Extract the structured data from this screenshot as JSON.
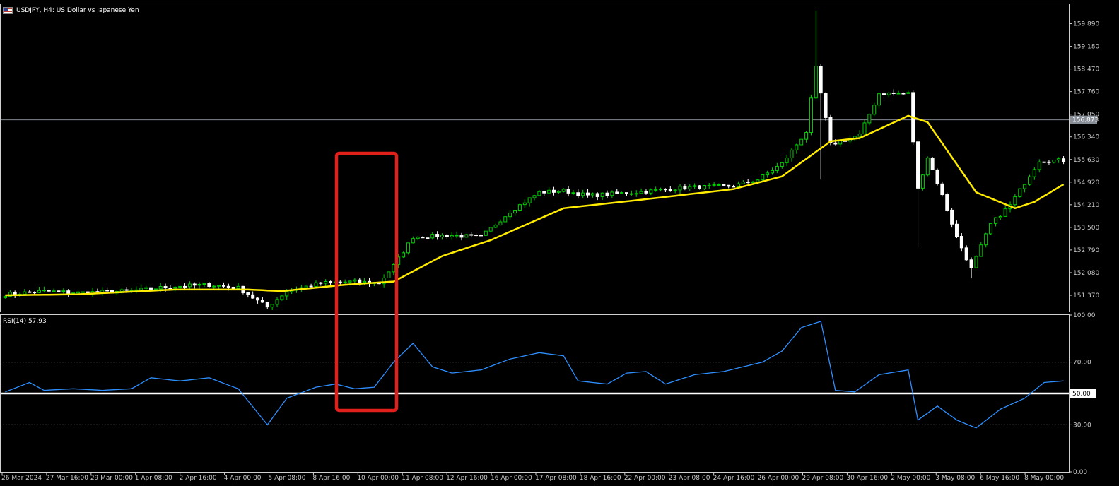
{
  "header": {
    "symbol_label": "USDJPY, H4:  US Dollar vs Japanese Yen",
    "flag_icon": "us-flag-icon"
  },
  "colors": {
    "background": "#000000",
    "grid_frame": "#d0d0d0",
    "candle_bull": "#00d000",
    "candle_bear": "#ffffff",
    "ma_line": "#ffeb00",
    "rsi_line": "#2f8fff",
    "rsi_mid_line": "#ffffff",
    "highlight_box": "#e0201b",
    "price_marker_bg": "#888f99"
  },
  "chart_data": [
    {
      "type": "candlestick",
      "name": "price",
      "ylim": [
        150.86,
        160.5
      ],
      "y_ticks": [
        "159.890",
        "159.180",
        "158.470",
        "157.760",
        "157.050",
        "156.340",
        "155.630",
        "154.920",
        "154.210",
        "153.500",
        "152.790",
        "152.080",
        "151.370"
      ],
      "current_price_label": "156.873",
      "current_price": 156.873,
      "x_tick_labels": [
        "26 Mar 2024",
        "27 Mar 16:00",
        "29 Mar 00:00",
        "1 Apr 08:00",
        "2 Apr 16:00",
        "4 Apr 00:00",
        "5 Apr 08:00",
        "8 Apr 16:00",
        "10 Apr 00:00",
        "11 Apr 08:00",
        "12 Apr 16:00",
        "16 Apr 00:00",
        "17 Apr 08:00",
        "18 Apr 16:00",
        "22 Apr 00:00",
        "23 Apr 08:00",
        "24 Apr 16:00",
        "26 Apr 00:00",
        "29 Apr 08:00",
        "30 Apr 16:00",
        "2 May 00:00",
        "3 May 08:00",
        "6 May 16:00",
        "8 May 00:00"
      ],
      "close_keyframes": [
        [
          0,
          151.4
        ],
        [
          8,
          151.5
        ],
        [
          15,
          151.45
        ],
        [
          25,
          151.5
        ],
        [
          35,
          151.65
        ],
        [
          42,
          151.7
        ],
        [
          48,
          151.6
        ],
        [
          54,
          151.0
        ],
        [
          58,
          151.5
        ],
        [
          65,
          151.75
        ],
        [
          72,
          151.8
        ],
        [
          77,
          151.75
        ],
        [
          80,
          152.3
        ],
        [
          84,
          153.2
        ],
        [
          92,
          153.25
        ],
        [
          98,
          153.2
        ],
        [
          104,
          154.0
        ],
        [
          110,
          154.6
        ],
        [
          115,
          154.65
        ],
        [
          120,
          154.5
        ],
        [
          130,
          154.6
        ],
        [
          140,
          154.75
        ],
        [
          150,
          154.8
        ],
        [
          155,
          155.0
        ],
        [
          160,
          155.5
        ],
        [
          165,
          156.5
        ],
        [
          167,
          158.5
        ],
        [
          170,
          156.1
        ],
        [
          176,
          156.4
        ],
        [
          180,
          157.7
        ],
        [
          186,
          157.7
        ],
        [
          188,
          154.7
        ],
        [
          190,
          155.7
        ],
        [
          193,
          154.5
        ],
        [
          196,
          153.2
        ],
        [
          199,
          152.2
        ],
        [
          203,
          153.6
        ],
        [
          207,
          154.2
        ],
        [
          213,
          155.6
        ],
        [
          218,
          155.6
        ]
      ],
      "moving_average_keyframes": [
        [
          0,
          151.37
        ],
        [
          15,
          151.4
        ],
        [
          35,
          151.55
        ],
        [
          50,
          151.55
        ],
        [
          57,
          151.5
        ],
        [
          70,
          151.7
        ],
        [
          80,
          151.8
        ],
        [
          90,
          152.6
        ],
        [
          100,
          153.1
        ],
        [
          115,
          154.1
        ],
        [
          130,
          154.35
        ],
        [
          150,
          154.7
        ],
        [
          160,
          155.1
        ],
        [
          170,
          156.2
        ],
        [
          176,
          156.3
        ],
        [
          186,
          157.0
        ],
        [
          190,
          156.8
        ],
        [
          195,
          155.7
        ],
        [
          200,
          154.6
        ],
        [
          208,
          154.1
        ],
        [
          212,
          154.3
        ],
        [
          218,
          154.85
        ]
      ]
    },
    {
      "type": "line",
      "name": "RSI(14)",
      "label": "RSI(14) 57.93",
      "ylim": [
        0,
        100
      ],
      "y_ticks": [
        "100.00",
        "70.00",
        "50.00",
        "30.00",
        "0.00"
      ],
      "levels": [
        30,
        50,
        70
      ],
      "rsi_keyframes": [
        [
          0,
          51
        ],
        [
          5,
          57
        ],
        [
          8,
          52
        ],
        [
          14,
          53
        ],
        [
          20,
          52
        ],
        [
          26,
          53
        ],
        [
          30,
          60
        ],
        [
          36,
          58
        ],
        [
          42,
          60
        ],
        [
          48,
          53
        ],
        [
          54,
          30
        ],
        [
          58,
          47
        ],
        [
          64,
          54
        ],
        [
          68,
          56
        ],
        [
          72,
          53
        ],
        [
          76,
          54
        ],
        [
          80,
          70
        ],
        [
          84,
          82
        ],
        [
          88,
          67
        ],
        [
          92,
          63
        ],
        [
          98,
          65
        ],
        [
          104,
          72
        ],
        [
          110,
          76
        ],
        [
          115,
          74
        ],
        [
          118,
          58
        ],
        [
          124,
          56
        ],
        [
          128,
          63
        ],
        [
          132,
          64
        ],
        [
          136,
          56
        ],
        [
          142,
          62
        ],
        [
          148,
          64
        ],
        [
          156,
          70
        ],
        [
          160,
          77
        ],
        [
          164,
          92
        ],
        [
          168,
          96
        ],
        [
          171,
          52
        ],
        [
          175,
          51
        ],
        [
          180,
          62
        ],
        [
          186,
          65
        ],
        [
          188,
          33
        ],
        [
          192,
          42
        ],
        [
          196,
          33
        ],
        [
          200,
          28
        ],
        [
          205,
          40
        ],
        [
          210,
          47
        ],
        [
          214,
          57
        ],
        [
          218,
          58
        ]
      ]
    }
  ],
  "annotation": {
    "type": "rectangle",
    "shape": "highlight-box"
  }
}
